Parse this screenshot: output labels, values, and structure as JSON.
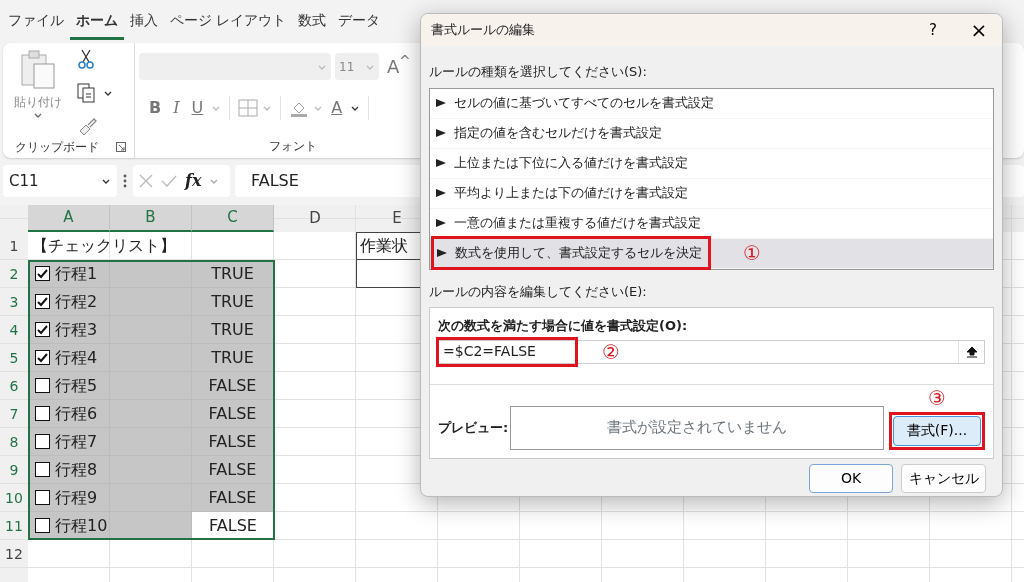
{
  "ribbon_tabs": [
    {
      "label": "ファイル",
      "selected": false
    },
    {
      "label": "ホーム",
      "selected": true
    },
    {
      "label": "挿入",
      "selected": false
    },
    {
      "label": "ページ レイアウト",
      "selected": false
    },
    {
      "label": "数式",
      "selected": false
    },
    {
      "label": "データ",
      "selected": false
    }
  ],
  "ribbon": {
    "clipboard": {
      "paste_label": "貼り付け",
      "group_label": "クリップボード"
    },
    "font": {
      "font_size": "11",
      "grow_font": "A$^{^}$",
      "bold": "B",
      "italic": "I",
      "underline": "U",
      "font_color": "A",
      "group_label": "フォント"
    }
  },
  "formula_bar": {
    "name_box": "C11",
    "fx": "fx",
    "value": "FALSE"
  },
  "sheet": {
    "columns": [
      "A",
      "B",
      "C",
      "D",
      "E"
    ],
    "row_numbers": [
      "1",
      "2",
      "3",
      "4",
      "5",
      "6",
      "7",
      "8",
      "9",
      "10",
      "11",
      "12"
    ],
    "title": "【チェックリスト】",
    "status_header": "作業状",
    "rows": [
      {
        "label": "行程1",
        "checked": true,
        "value": "TRUE",
        "active": false
      },
      {
        "label": "行程2",
        "checked": true,
        "value": "TRUE",
        "active": false
      },
      {
        "label": "行程3",
        "checked": true,
        "value": "TRUE",
        "active": false
      },
      {
        "label": "行程4",
        "checked": true,
        "value": "TRUE",
        "active": false
      },
      {
        "label": "行程5",
        "checked": false,
        "value": "FALSE",
        "active": false
      },
      {
        "label": "行程6",
        "checked": false,
        "value": "FALSE",
        "active": false
      },
      {
        "label": "行程7",
        "checked": false,
        "value": "FALSE",
        "active": false
      },
      {
        "label": "行程8",
        "checked": false,
        "value": "FALSE",
        "active": false
      },
      {
        "label": "行程9",
        "checked": false,
        "value": "FALSE",
        "active": false
      },
      {
        "label": "行程10",
        "checked": false,
        "value": "FALSE",
        "active": true
      }
    ]
  },
  "dialog": {
    "title": "書式ルールの編集",
    "help": "?",
    "close": "×",
    "rule_type_label": "ルールの種類を選択してください(S):",
    "rule_types": [
      {
        "label": "セルの値に基づいてすべてのセルを書式設定",
        "selected": false
      },
      {
        "label": "指定の値を含むセルだけを書式設定",
        "selected": false
      },
      {
        "label": "上位または下位に入る値だけを書式設定",
        "selected": false
      },
      {
        "label": "平均より上または下の値だけを書式設定",
        "selected": false
      },
      {
        "label": "一意の値または重複する値だけを書式設定",
        "selected": false
      },
      {
        "label": "数式を使用して、書式設定するセルを決定",
        "selected": true,
        "annotation": "①"
      }
    ],
    "rule_edit_label": "ルールの内容を編集してください(E):",
    "formula_label": "次の数式を満たす場合に値を書式設定(O):",
    "formula": "=$C2=FALSE",
    "formula_annotation": "②",
    "preview_label": "プレビュー:",
    "preview_text": "書式が設定されていません",
    "format_button": "書式(F)...",
    "format_annotation": "③",
    "ok": "OK",
    "cancel": "キャンセル"
  }
}
